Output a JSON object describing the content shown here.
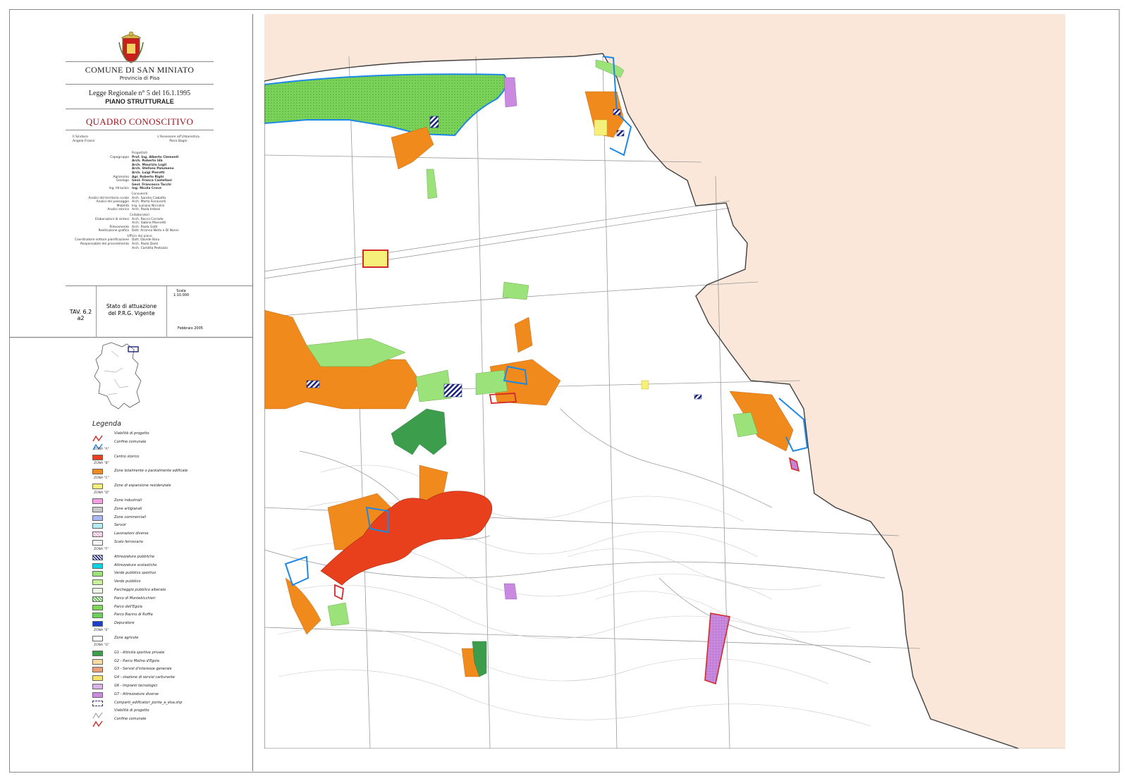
{
  "title_block": {
    "comune": "COMUNE DI SAN MINIATO",
    "provincia": "Provincia di Pisa",
    "legge": "Legge Regionale n° 5 del 16.1.1995",
    "piano": "PIANO STRUTTURALE",
    "quadro": "QUADRO CONOSCITIVO",
    "sindaco_role": "Il Sindaco",
    "sindaco_name": "Angelo Frosini",
    "assessore_role": "L'Assessore all'Urbanistica",
    "assessore_name": "Piero Bagni"
  },
  "credits": [
    {
      "section": "Progettisti"
    },
    {
      "role": "Capogruppo",
      "name": "Prof. Ing. Alberto Clementi",
      "bold": true
    },
    {
      "role": "",
      "name": "Arch. Roberto Idà",
      "bold": true
    },
    {
      "role": "",
      "name": "Arch. Maurizio Logli",
      "bold": true
    },
    {
      "role": "",
      "name": "Arch. Stefano Palumeno",
      "bold": true
    },
    {
      "role": "",
      "name": "Arch. Luigi Pierotti",
      "bold": true
    },
    {
      "role": "Agronomo",
      "name": "Agr. Roberto Righi",
      "bold": true
    },
    {
      "role": "Geologo",
      "name": "Geol. Franca Castellani",
      "bold": true
    },
    {
      "role": "",
      "name": "Geol. Francesco Tacchi",
      "bold": true
    },
    {
      "role": "Ing. Idraulico",
      "name": "Ing. Nicola Croce",
      "bold": true
    },
    {
      "section": "Consulenti"
    },
    {
      "role": "Analisi del territorio rurale",
      "name": "Arch. Sandro Ciabatta"
    },
    {
      "role": "Analisi del paesaggio",
      "name": "Arch. Marta Fioravanti"
    },
    {
      "role": "Mobilità",
      "name": "Ing. Luciano Niccolini"
    },
    {
      "role": "Analisi storica",
      "name": "Arch. Paola Imbesi"
    },
    {
      "section": "Collaboratori"
    },
    {
      "role": "Elaborazioni di sintesi",
      "name": "Arch. Rocco Corrado"
    },
    {
      "role": "",
      "name": "Arch. Sabina Mannetti"
    },
    {
      "role": "Rilevamento",
      "name": "Arch. Paola Gatti"
    },
    {
      "role": "Restituzione grafica",
      "name": "Dott. Arianna Nieto e Di Nanni"
    },
    {
      "section": "Ufficio del piano"
    },
    {
      "role": "Coordinatore settore pianificazione",
      "name": "Dott. Davide Baru"
    },
    {
      "role": "Responsabile del procedimento",
      "name": "Arch. Paolo Dami"
    },
    {
      "role": "",
      "name": "Arch. Carlotta Pestazzo"
    }
  ],
  "tav": {
    "number": "TAV. 6.2 a2",
    "desc_1": "Stato di attuazione",
    "desc_2": "del P.R.G. Vigente",
    "scale_label": "Scala",
    "scale_value": "1:10.000",
    "date": "Febbraio 2005"
  },
  "legend": {
    "title": "Legenda",
    "items": [
      {
        "type": "line",
        "color": "#d12a2a",
        "label": "Viabilità di progetto"
      },
      {
        "type": "line",
        "color": "#1e88e5",
        "label": "Confine comunale"
      },
      {
        "type": "header",
        "label": "ZONA \"A\""
      },
      {
        "type": "fill",
        "color": "#e8401c",
        "label": "Centro storico"
      },
      {
        "type": "header",
        "label": "ZONA \"B\""
      },
      {
        "type": "fill",
        "color": "#f08a1c",
        "label": "Zone totalmente o parzialmente edificate"
      },
      {
        "type": "header",
        "label": "ZONA \"C\""
      },
      {
        "type": "fill",
        "color": "#f5f07a",
        "label": "Zone di espansione residenziale"
      },
      {
        "type": "header",
        "label": "ZONA \"D\""
      },
      {
        "type": "fill",
        "color": "#f3a0e0",
        "label": "Zone industriali"
      },
      {
        "type": "fill",
        "color": "#c9c9c9",
        "label": "Zone artigianali"
      },
      {
        "type": "fill",
        "color": "#a9b6ef",
        "label": "Zone commerciali"
      },
      {
        "type": "fill",
        "color": "#b5ecf2",
        "label": "Servizi"
      },
      {
        "type": "hatch",
        "color": "#f3a8d6",
        "label": "Lavorazioni diverse"
      },
      {
        "type": "fill",
        "color": "#f5f5f5",
        "label": "Scalo ferroviario"
      },
      {
        "type": "header",
        "label": "ZONA \"F\""
      },
      {
        "type": "hatch",
        "color": "#1a237e",
        "label": "Attrezzature pubbliche"
      },
      {
        "type": "fill",
        "color": "#12d0e0",
        "label": "Attrezzature scolastiche"
      },
      {
        "type": "fill",
        "color": "#9be27a",
        "label": "Verde pubblico sportivo"
      },
      {
        "type": "fill",
        "color": "#c8ef9a",
        "label": "Verde pubblico"
      },
      {
        "type": "fill",
        "color": "#eef8e6",
        "label": "Parcheggio pubblico alberato"
      },
      {
        "type": "hatch",
        "color": "#58b845",
        "label": "Parco di Montebicchieri"
      },
      {
        "type": "fill",
        "color": "#7fd45a",
        "label": "Parco dell'Egola"
      },
      {
        "type": "fill",
        "color": "#6ed05a",
        "label": "Parco Bacino di Roffia"
      },
      {
        "type": "fill",
        "color": "#1d3fc7",
        "label": "Depuratore"
      },
      {
        "type": "header",
        "label": "ZONA \"E\""
      },
      {
        "type": "fill",
        "color": "#ffffff",
        "label": "Zone agricole"
      },
      {
        "type": "header",
        "label": "ZONA \"G\""
      },
      {
        "type": "fill",
        "color": "#3c9e4c",
        "label": "G1 - Attività sportive private"
      },
      {
        "type": "fill",
        "color": "#f5dba8",
        "label": "G2 - Parco Molino d'Egola"
      },
      {
        "type": "fill",
        "color": "#e9a07a",
        "label": "G3 - Servizi d'interesse generale"
      },
      {
        "type": "fill",
        "color": "#f3e36a",
        "label": "G4 - stazione di servizi carburante"
      },
      {
        "type": "fill",
        "color": "#d9b2e6",
        "label": "G6 - Impianti tecnologici"
      },
      {
        "type": "fill",
        "color": "#c98ae0",
        "label": "G7 - Attrezzature diverse"
      },
      {
        "type": "dashed",
        "color": "#2b2b8a",
        "label": "Comparti_edificatori_ponte_a_elsa.shp"
      },
      {
        "type": "line",
        "color": "#b0b0b0",
        "label": "Viabilità di progetto"
      },
      {
        "type": "line",
        "color": "#d12a2a",
        "label": "Confine comunale"
      }
    ]
  },
  "map": {
    "background": "#ffffff",
    "outside_color": "#fbe7da",
    "colors": {
      "river_park": "#7bd45a",
      "boundary": "#1e88e5",
      "centro_storico": "#e8401c",
      "residential": "#f08a1c",
      "green": "#9be27a",
      "sport_private": "#3c9e4c",
      "purple": "#c98ae0",
      "yellow": "#f5f07a",
      "red_outline": "#d12a2a"
    }
  }
}
